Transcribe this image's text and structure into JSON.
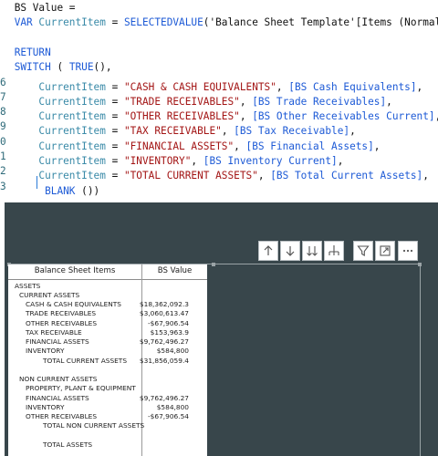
{
  "code": {
    "lines": [
      {
        "num": "",
        "parts": [
          {
            "t": "BS Value =",
            "c": "plain"
          }
        ]
      },
      {
        "num": "",
        "parts": [
          {
            "t": "VAR ",
            "c": "kw"
          },
          {
            "t": "CurrentItem",
            "c": "vn"
          },
          {
            "t": " = ",
            "c": "plain"
          },
          {
            "t": "SELECTEDVALUE",
            "c": "fn"
          },
          {
            "t": "('Balance Sheet Template'[Items (Normalized)])",
            "c": "plain"
          }
        ]
      },
      {
        "num": "",
        "parts": []
      },
      {
        "num": "",
        "parts": [
          {
            "t": "RETURN",
            "c": "kw"
          }
        ]
      },
      {
        "num": "",
        "parts": [
          {
            "t": "SWITCH",
            "c": "fn"
          },
          {
            "t": " ( ",
            "c": "plain"
          },
          {
            "t": "TRUE",
            "c": "fn"
          },
          {
            "t": "(),",
            "c": "plain"
          }
        ]
      },
      {
        "num": "6",
        "parts": [
          {
            "t": "    ",
            "c": "plain"
          },
          {
            "t": "CurrentItem",
            "c": "vn"
          },
          {
            "t": " = ",
            "c": "plain"
          },
          {
            "t": "\"CASH & CASH EQUIVALENTS\"",
            "c": "str"
          },
          {
            "t": ", ",
            "c": "plain"
          },
          {
            "t": "[BS Cash Equivalents]",
            "c": "col"
          },
          {
            "t": ",",
            "c": "plain"
          }
        ]
      },
      {
        "num": "7",
        "parts": [
          {
            "t": "    ",
            "c": "plain"
          },
          {
            "t": "CurrentItem",
            "c": "vn"
          },
          {
            "t": " = ",
            "c": "plain"
          },
          {
            "t": "\"TRADE RECEIVABLES\"",
            "c": "str"
          },
          {
            "t": ", ",
            "c": "plain"
          },
          {
            "t": "[BS Trade Receivables]",
            "c": "col"
          },
          {
            "t": ",",
            "c": "plain"
          }
        ]
      },
      {
        "num": "8",
        "parts": [
          {
            "t": "    ",
            "c": "plain"
          },
          {
            "t": "CurrentItem",
            "c": "vn"
          },
          {
            "t": " = ",
            "c": "plain"
          },
          {
            "t": "\"OTHER RECEIVABLES\"",
            "c": "str"
          },
          {
            "t": ", ",
            "c": "plain"
          },
          {
            "t": "[BS Other Receivables Current]",
            "c": "col"
          },
          {
            "t": ",",
            "c": "plain"
          }
        ]
      },
      {
        "num": "9",
        "parts": [
          {
            "t": "    ",
            "c": "plain"
          },
          {
            "t": "CurrentItem",
            "c": "vn"
          },
          {
            "t": " = ",
            "c": "plain"
          },
          {
            "t": "\"TAX RECEIVABLE\"",
            "c": "str"
          },
          {
            "t": ", ",
            "c": "plain"
          },
          {
            "t": "[BS Tax Receivable]",
            "c": "col"
          },
          {
            "t": ",",
            "c": "plain"
          }
        ]
      },
      {
        "num": "0",
        "parts": [
          {
            "t": "    ",
            "c": "plain"
          },
          {
            "t": "CurrentItem",
            "c": "vn"
          },
          {
            "t": " = ",
            "c": "plain"
          },
          {
            "t": "\"FINANCIAL ASSETS\"",
            "c": "str"
          },
          {
            "t": ", ",
            "c": "plain"
          },
          {
            "t": "[BS Financial Assets]",
            "c": "col"
          },
          {
            "t": ",",
            "c": "plain"
          }
        ]
      },
      {
        "num": "1",
        "parts": [
          {
            "t": "    ",
            "c": "plain"
          },
          {
            "t": "CurrentItem",
            "c": "vn"
          },
          {
            "t": " = ",
            "c": "plain"
          },
          {
            "t": "\"INVENTORY\"",
            "c": "str"
          },
          {
            "t": ", ",
            "c": "plain"
          },
          {
            "t": "[BS Inventory Current]",
            "c": "col"
          },
          {
            "t": ",",
            "c": "plain"
          }
        ]
      },
      {
        "num": "2",
        "parts": [
          {
            "t": "    ",
            "c": "plain"
          },
          {
            "t": "CurrentItem",
            "c": "vn"
          },
          {
            "t": " = ",
            "c": "plain"
          },
          {
            "t": "\"TOTAL CURRENT ASSETS\"",
            "c": "str"
          },
          {
            "t": ", ",
            "c": "plain"
          },
          {
            "t": "[BS Total Current Assets]",
            "c": "col"
          },
          {
            "t": ",",
            "c": "plain"
          }
        ]
      },
      {
        "num": "3",
        "parts": [
          {
            "t": "     ",
            "c": "plain"
          },
          {
            "t": "BLANK",
            "c": "fn"
          },
          {
            "t": " ())",
            "c": "plain"
          }
        ]
      }
    ]
  },
  "toolbar": {
    "buttons": [
      "drill-up-icon",
      "drill-down-icon",
      "expand-all-icon",
      "hierarchy-icon",
      "filter-icon",
      "focus-mode-icon",
      "more-options-icon"
    ]
  },
  "matrix": {
    "col_items": "Balance Sheet Items",
    "col_value": "BS Value",
    "rows": [
      {
        "label": "ASSETS",
        "value": "",
        "indent": 0
      },
      {
        "label": "CURRENT ASSETS",
        "value": "",
        "indent": 1
      },
      {
        "label": "CASH & CASH EQUIVALENTS",
        "value": "$18,362,092.3",
        "indent": 2
      },
      {
        "label": "TRADE RECEIVABLES",
        "value": "$3,060,613.47",
        "indent": 2
      },
      {
        "label": "OTHER RECEIVABLES",
        "value": "-$67,906.54",
        "indent": 2
      },
      {
        "label": "TAX RECEIVABLE",
        "value": "$153,963.9",
        "indent": 2
      },
      {
        "label": "FINANCIAL ASSETS",
        "value": "$9,762,496.27",
        "indent": 2
      },
      {
        "label": "INVENTORY",
        "value": "$584,800",
        "indent": 2
      },
      {
        "label": "TOTAL CURRENT ASSETS",
        "value": "$31,856,059.4",
        "indent": 3
      },
      {
        "label": "",
        "value": "",
        "indent": 0
      },
      {
        "label": "NON CURRENT ASSETS",
        "value": "",
        "indent": 1
      },
      {
        "label": "PROPERTY, PLANT & EQUIPMENT",
        "value": "",
        "indent": 2
      },
      {
        "label": "FINANCIAL ASSETS",
        "value": "$9,762,496.27",
        "indent": 2
      },
      {
        "label": "INVENTORY",
        "value": "$584,800",
        "indent": 2
      },
      {
        "label": "OTHER RECEIVABLES",
        "value": "-$67,906.54",
        "indent": 2
      },
      {
        "label": "TOTAL NON CURRENT ASSETS",
        "value": "",
        "indent": 3
      },
      {
        "label": "",
        "value": "",
        "indent": 0
      },
      {
        "label": "TOTAL ASSETS",
        "value": "",
        "indent": 3
      }
    ]
  },
  "colors": {
    "canvas_bg": "#38464b",
    "keyword": "#1d5ad6",
    "string": "#a31515",
    "variable": "#3a8aa8"
  }
}
